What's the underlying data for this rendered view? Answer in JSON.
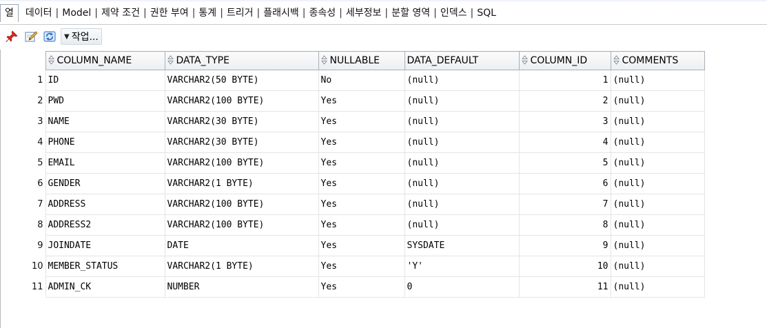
{
  "tabs": [
    {
      "label": "열",
      "active": true
    },
    {
      "label": "데이터"
    },
    {
      "label": "Model"
    },
    {
      "label": "제약 조건"
    },
    {
      "label": "권한 부여"
    },
    {
      "label": "통계"
    },
    {
      "label": "트리거"
    },
    {
      "label": "플래시백"
    },
    {
      "label": "종속성"
    },
    {
      "label": "세부정보"
    },
    {
      "label": "분할 영역"
    },
    {
      "label": "인덱스"
    },
    {
      "label": "SQL"
    }
  ],
  "tab_separator": "|",
  "toolbar": {
    "pin_icon": "pin-icon",
    "edit_icon": "edit-icon",
    "refresh_icon": "refresh-icon",
    "actions_label": "작업...",
    "actions_caret": "▼"
  },
  "grid": {
    "columns": [
      "COLUMN_NAME",
      "DATA_TYPE",
      "NULLABLE",
      "DATA_DEFAULT",
      "COLUMN_ID",
      "COMMENTS"
    ],
    "rows": [
      {
        "num": "1",
        "cells": [
          "ID",
          "VARCHAR2(50 BYTE)",
          "No",
          "(null)",
          "1",
          "(null)"
        ]
      },
      {
        "num": "2",
        "cells": [
          "PWD",
          "VARCHAR2(100 BYTE)",
          "Yes",
          "(null)",
          "2",
          "(null)"
        ]
      },
      {
        "num": "3",
        "cells": [
          "NAME",
          "VARCHAR2(30 BYTE)",
          "Yes",
          "(null)",
          "3",
          "(null)"
        ]
      },
      {
        "num": "4",
        "cells": [
          "PHONE",
          "VARCHAR2(30 BYTE)",
          "Yes",
          "(null)",
          "4",
          "(null)"
        ]
      },
      {
        "num": "5",
        "cells": [
          "EMAIL",
          "VARCHAR2(100 BYTE)",
          "Yes",
          "(null)",
          "5",
          "(null)"
        ]
      },
      {
        "num": "6",
        "cells": [
          "GENDER",
          "VARCHAR2(1 BYTE)",
          "Yes",
          "(null)",
          "6",
          "(null)"
        ]
      },
      {
        "num": "7",
        "cells": [
          "ADDRESS",
          "VARCHAR2(100 BYTE)",
          "Yes",
          "(null)",
          "7",
          "(null)"
        ]
      },
      {
        "num": "8",
        "cells": [
          "ADDRESS2",
          "VARCHAR2(100 BYTE)",
          "Yes",
          "(null)",
          "8",
          "(null)"
        ]
      },
      {
        "num": "9",
        "cells": [
          "JOINDATE",
          "DATE",
          "Yes",
          "SYSDATE",
          "9",
          "(null)"
        ]
      },
      {
        "num": "10",
        "cells": [
          "MEMBER_STATUS",
          "VARCHAR2(1 BYTE)",
          "Yes",
          "'Y'",
          "10",
          "(null)"
        ]
      },
      {
        "num": "11",
        "cells": [
          "ADMIN_CK",
          "NUMBER",
          "Yes",
          "0",
          "11",
          "(null)"
        ]
      }
    ]
  },
  "colors": {
    "pin": "#d8261c",
    "refresh": "#2f6fc9",
    "header_border": "#a9afb8"
  }
}
